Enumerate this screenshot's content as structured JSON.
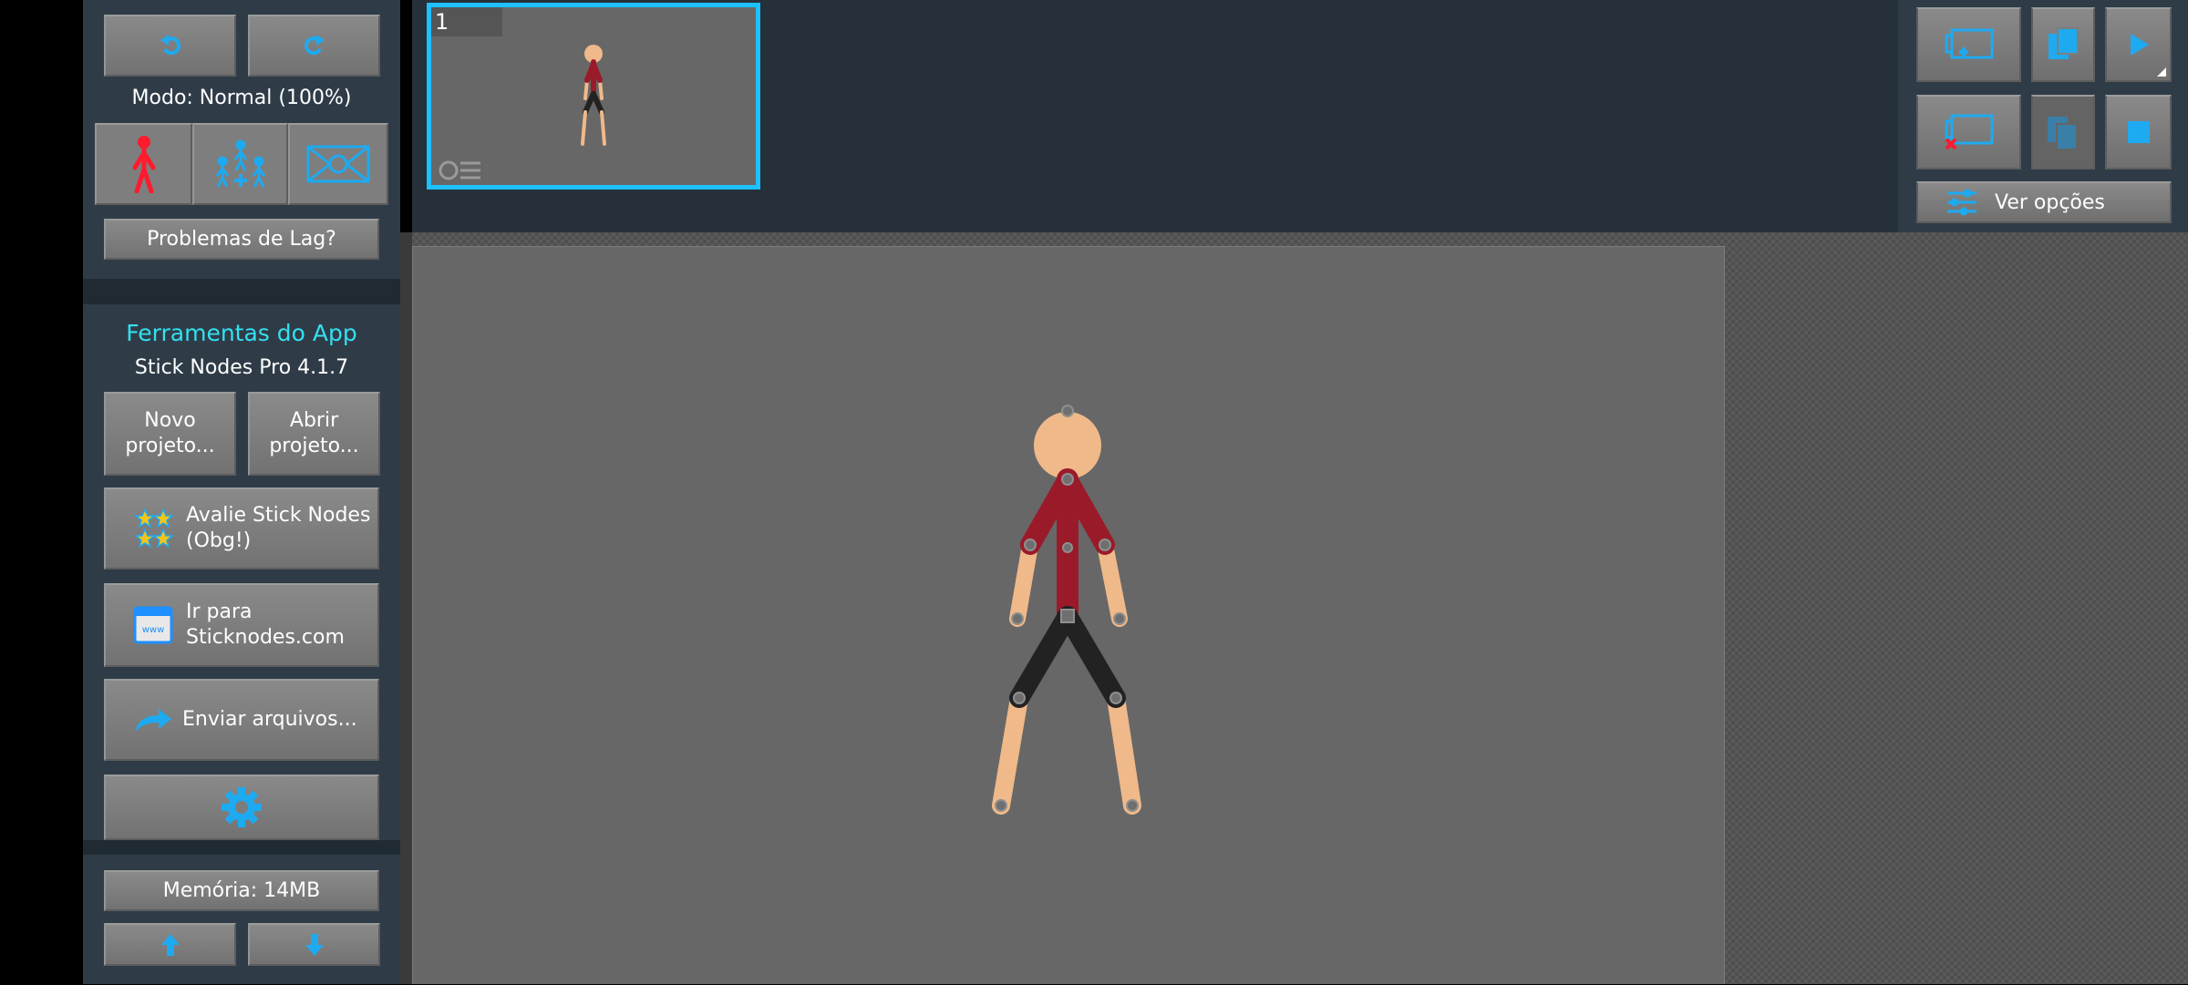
{
  "left_panel": {
    "mode_label": "Modo: Normal (100%)",
    "lag_button": "Problemas de Lag?",
    "tools_heading": "Ferramentas do App",
    "app_version": "Stick Nodes Pro 4.1.7",
    "new_project_line1": "Novo",
    "new_project_line2": "projeto...",
    "open_project_line1": "Abrir",
    "open_project_line2": "projeto...",
    "rate_line1": "Avalie Stick Nodes",
    "rate_line2": "(Obg!)",
    "website_line1": "Ir para",
    "website_line2": "Sticknodes.com",
    "send_files": "Enviar arquivos...",
    "memory": "Memória: 14MB"
  },
  "timeline": {
    "frame_number": "1"
  },
  "right_panel": {
    "view_options": "Ver opções"
  },
  "colors": {
    "accent": "#1ec0ff",
    "heading": "#33e0f0",
    "panel": "#2f3c48",
    "stage": "#676767",
    "shirt": "#9b1a2a",
    "pants": "#222222",
    "skin": "#f0b98a",
    "selected_figure": "#ff1a2e"
  },
  "icons": [
    "undo-icon",
    "redo-icon",
    "stickfigure-icon",
    "group-icon",
    "stage-icon",
    "star-icon",
    "web-icon",
    "share-icon",
    "gear-icon",
    "arrow-up-icon",
    "arrow-down-icon",
    "add-frame-icon",
    "copy-frame-icon",
    "play-icon",
    "delete-frame-icon",
    "paste-frame-icon",
    "stop-icon",
    "sliders-icon"
  ]
}
